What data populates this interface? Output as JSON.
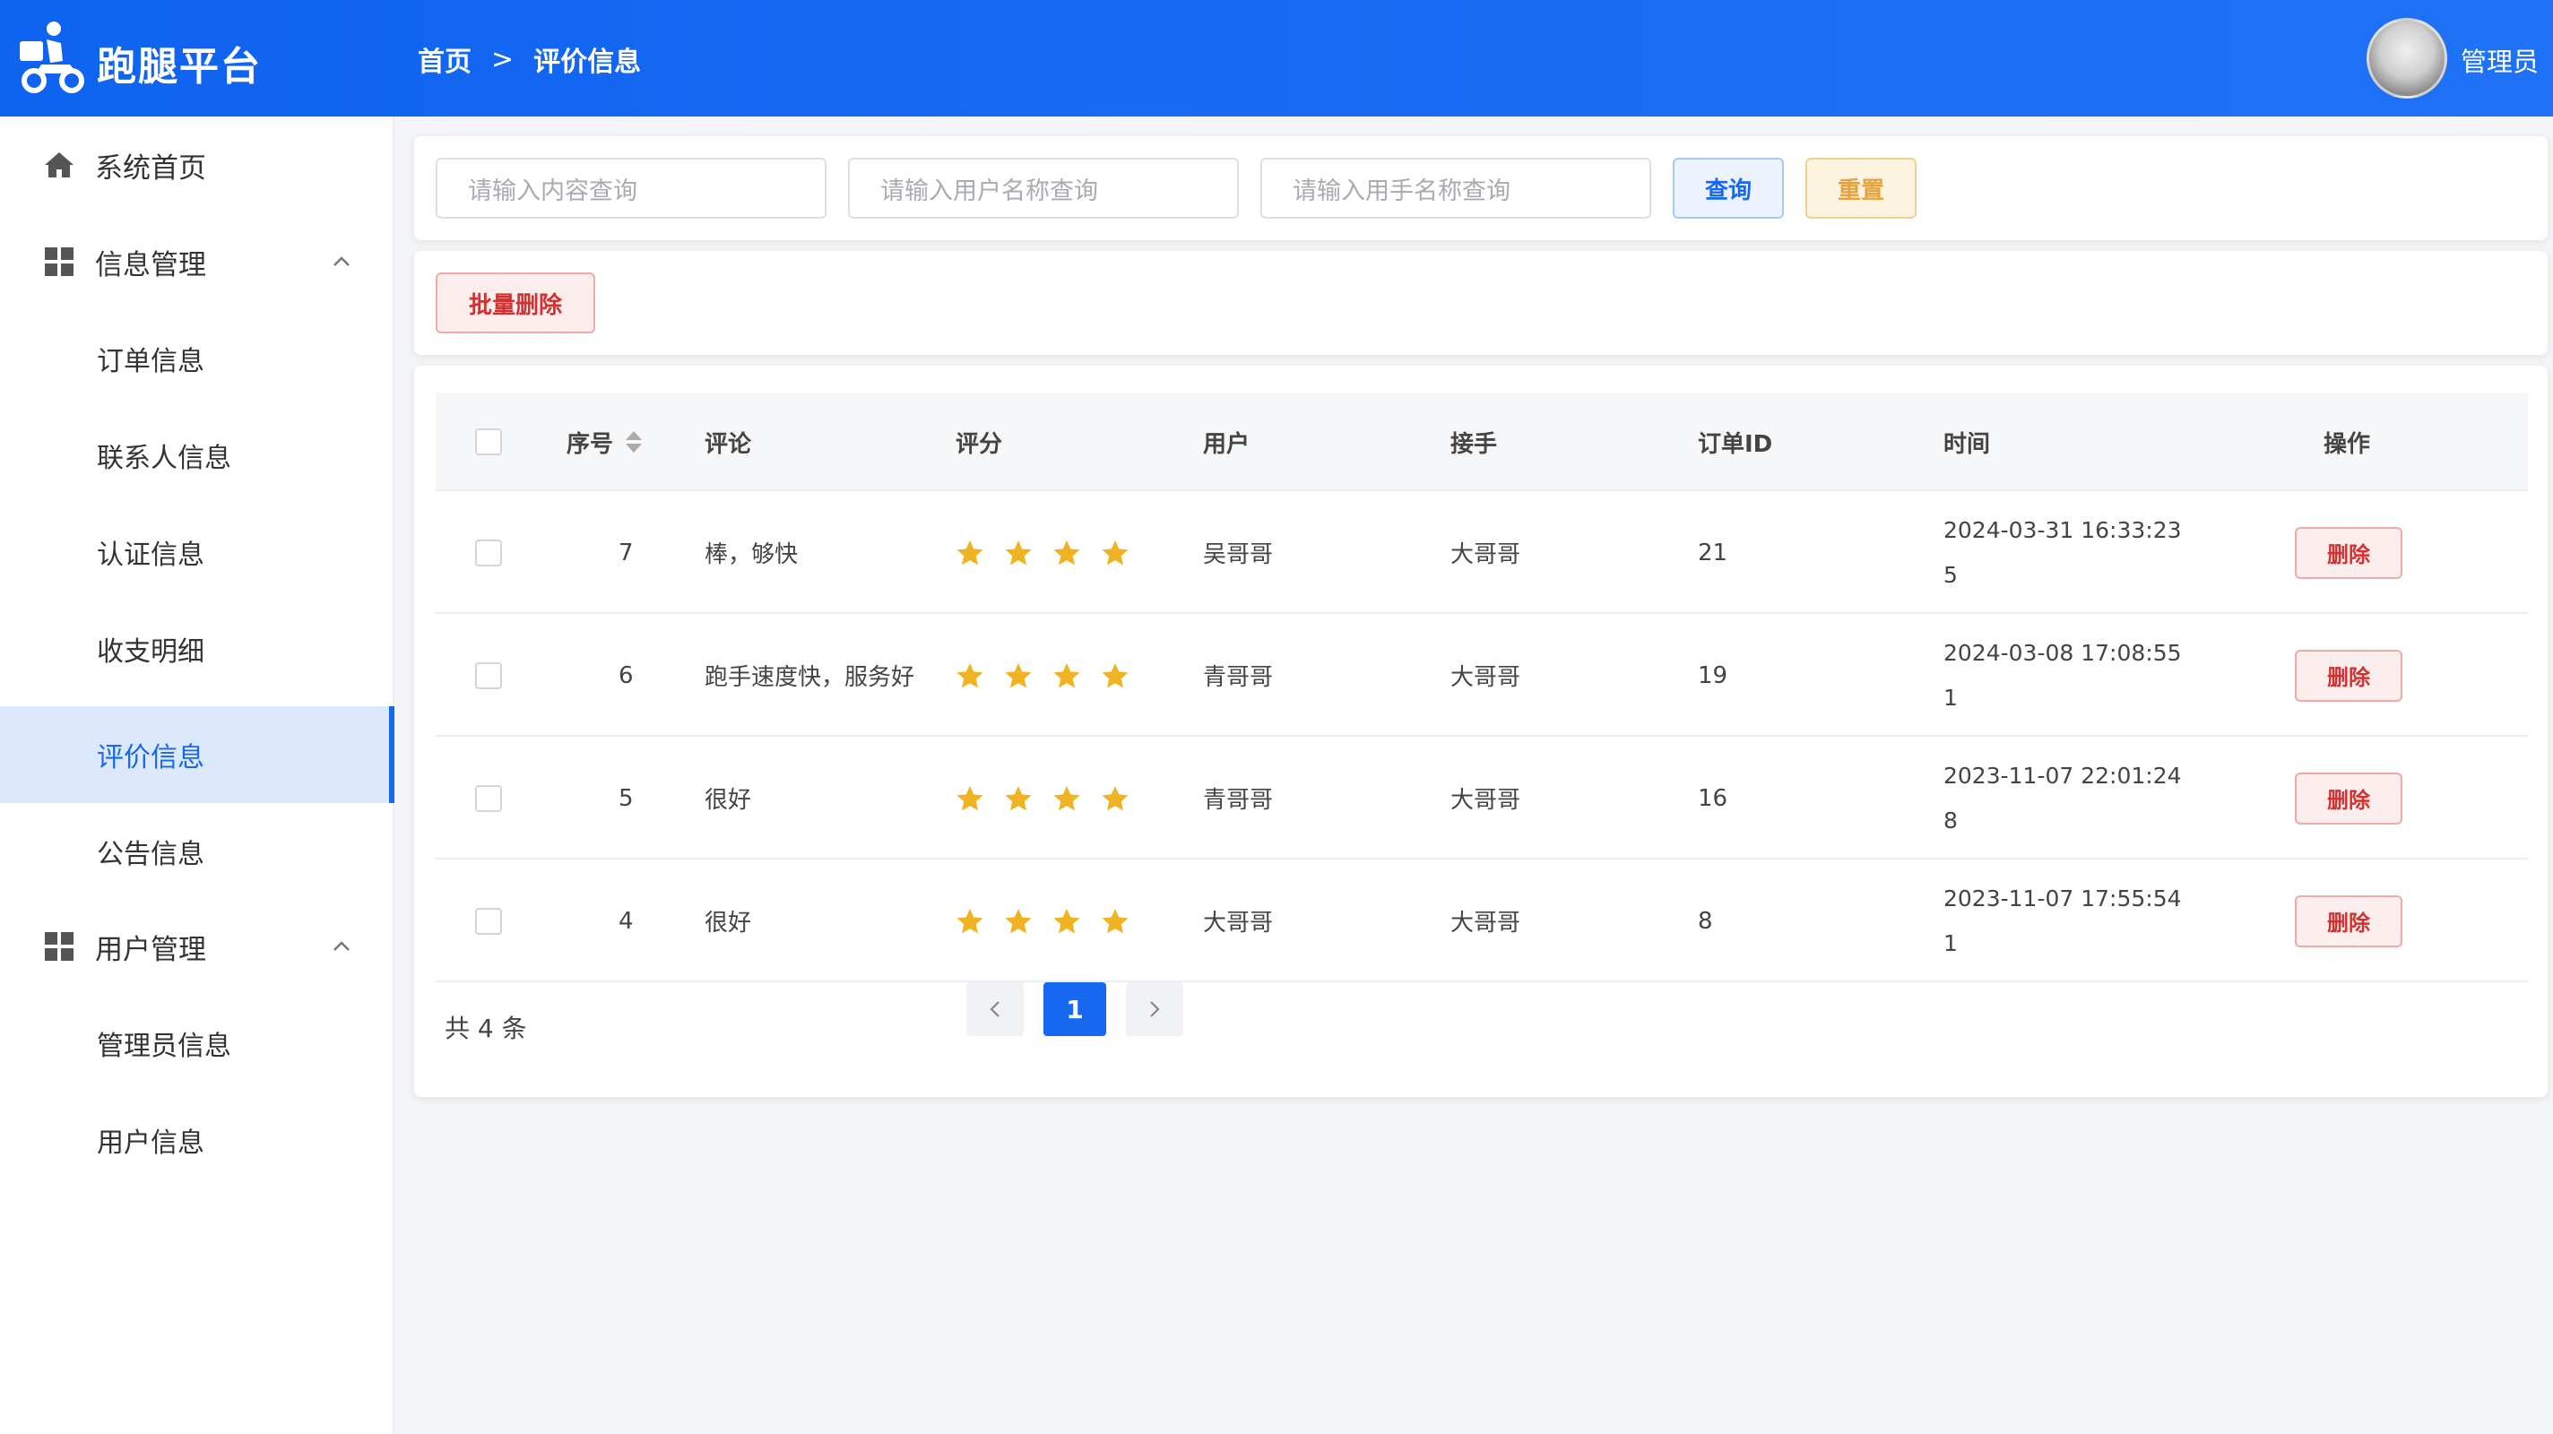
{
  "header": {
    "brand": "跑腿平台",
    "breadcrumb": [
      "首页",
      ">",
      "评价信息"
    ],
    "admin_name": "管理员"
  },
  "sidebar": {
    "home": "系统首页",
    "groups": [
      {
        "label": "信息管理",
        "items": [
          "订单信息",
          "联系人信息",
          "认证信息",
          "收支明细",
          "评价信息",
          "公告信息"
        ]
      },
      {
        "label": "用户管理",
        "items": [
          "管理员信息",
          "用户信息"
        ]
      }
    ],
    "active_item": "评价信息"
  },
  "search": {
    "content_placeholder": "请输入内容查询",
    "user_placeholder": "请输入用户名称查询",
    "runner_placeholder": "请输入用手名称查询",
    "query_label": "查询",
    "reset_label": "重置"
  },
  "actions": {
    "batch_delete_label": "批量删除"
  },
  "table": {
    "columns": [
      "序号",
      "评论",
      "评分",
      "用户",
      "接手",
      "订单ID",
      "时间",
      "操作"
    ],
    "rows": [
      {
        "id": "7",
        "comment": "棒，够快",
        "rating": 4,
        "user": "吴哥哥",
        "runner": "大哥哥",
        "order_id": "21",
        "time_line1": "2024-03-31 16:33:23",
        "time_line2": "5",
        "delete_label": "删除"
      },
      {
        "id": "6",
        "comment": "跑手速度快，服务好",
        "rating": 4,
        "user": "青哥哥",
        "runner": "大哥哥",
        "order_id": "19",
        "time_line1": "2024-03-08 17:08:55",
        "time_line2": "1",
        "delete_label": "删除"
      },
      {
        "id": "5",
        "comment": "很好",
        "rating": 4,
        "user": "青哥哥",
        "runner": "大哥哥",
        "order_id": "16",
        "time_line1": "2023-11-07 22:01:24",
        "time_line2": "8",
        "delete_label": "删除"
      },
      {
        "id": "4",
        "comment": "很好",
        "rating": 4,
        "user": "大哥哥",
        "runner": "大哥哥",
        "order_id": "8",
        "time_line1": "2023-11-07 17:55:54",
        "time_line2": "1",
        "delete_label": "删除"
      }
    ]
  },
  "pagination": {
    "total_label": "共 4 条",
    "current_page": "1",
    "prev": "<",
    "next": ">"
  },
  "colors": {
    "primary": "#1668f0",
    "star": "#f0b323",
    "danger": "#d43030",
    "warning": "#e6a23c"
  }
}
